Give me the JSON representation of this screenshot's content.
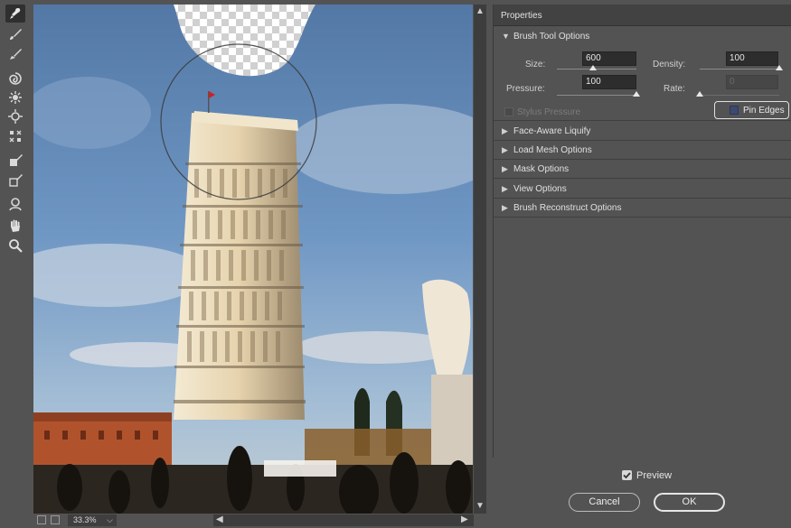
{
  "panel": {
    "title": "Properties",
    "brush_section": "Brush Tool Options",
    "size_label": "Size:",
    "size_value": "600",
    "density_label": "Density:",
    "density_value": "100",
    "pressure_label": "Pressure:",
    "pressure_value": "100",
    "rate_label": "Rate:",
    "rate_value": "0",
    "stylus_label": "Stylus Pressure",
    "pin_edges_label": "Pin Edges",
    "sliders": {
      "size": 0.45,
      "density": 1.0,
      "pressure": 1.0,
      "rate": 0.0
    },
    "sections": [
      "Face-Aware Liquify",
      "Load Mesh Options",
      "Mask Options",
      "View Options",
      "Brush Reconstruct Options"
    ]
  },
  "footer": {
    "preview_label": "Preview",
    "cancel_label": "Cancel",
    "ok_label": "OK"
  },
  "status": {
    "zoom": "33.3%"
  },
  "colors": {
    "accent_border": "#e6e6e6",
    "panel_bg": "#535353",
    "field_bg": "#2d2d2d"
  },
  "icons": [
    "forward-warp-icon",
    "reconstruct-icon",
    "smooth-icon",
    "twirl-icon",
    "pucker-icon",
    "bloat-icon",
    "push-left-icon",
    "freeze-mask-icon",
    "thaw-mask-icon",
    "face-tool-icon",
    "hand-icon",
    "zoom-icon"
  ]
}
